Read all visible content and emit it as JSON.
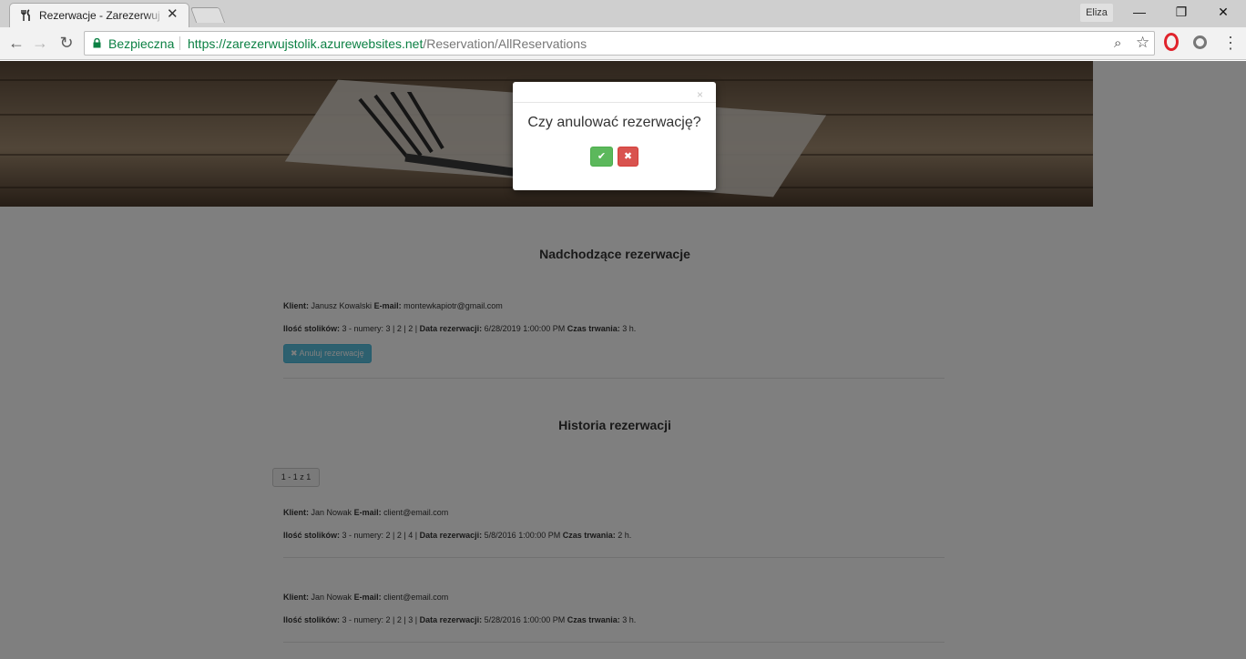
{
  "browser": {
    "tab_title": "Rezerwacje - Zarezerwuj Stolik",
    "tab_close": "✕",
    "profile_name": "Eliza",
    "window_minimize": "—",
    "window_restore": "❐",
    "window_close": "✕",
    "back": "←",
    "forward": "→",
    "reload": "↻",
    "security_label": "Bezpieczna",
    "url_host": "https://zarezerwujstolik.azurewebsites.net",
    "url_path": "/Reservation/AllReservations",
    "zoom": "⌕",
    "bookmark": "☆",
    "menu": "⋮"
  },
  "page": {
    "upcoming_title": "Nadchodzące rezerwacje",
    "history_title": "Historia rezerwacji",
    "labels": {
      "client": "Klient:",
      "email": "E-mail:",
      "tables": "Ilość stolików:",
      "date": "Data rezerwacji:",
      "duration": "Czas trwania:"
    },
    "upcoming": [
      {
        "client": "Janusz Kowalski",
        "email": "montewkapiotr@gmail.com",
        "tables": "3 - numery: 3 | 2 | 2 |",
        "date": "6/28/2019 1:00:00 PM",
        "duration": "3 h.",
        "cancel_label": "✖ Anuluj rezerwację"
      }
    ],
    "pager": "1 - 1 z 1",
    "history": [
      {
        "client": "Jan Nowak",
        "email": "client@email.com",
        "tables": "3 - numery: 2 | 2 | 4 |",
        "date": "5/8/2016 1:00:00 PM",
        "duration": "2 h."
      },
      {
        "client": "Jan Nowak",
        "email": "client@email.com",
        "tables": "3 - numery: 2 | 2 | 3 |",
        "date": "5/28/2016 1:00:00 PM",
        "duration": "3 h."
      }
    ]
  },
  "modal": {
    "close": "×",
    "question": "Czy anulować rezerwację?",
    "confirm_icon": "✔",
    "cancel_icon": "✖"
  },
  "colors": {
    "secure_green": "#0b8043",
    "info_button": "#5bc0de",
    "success_button": "#5cb85c",
    "danger_button": "#d9534f"
  }
}
